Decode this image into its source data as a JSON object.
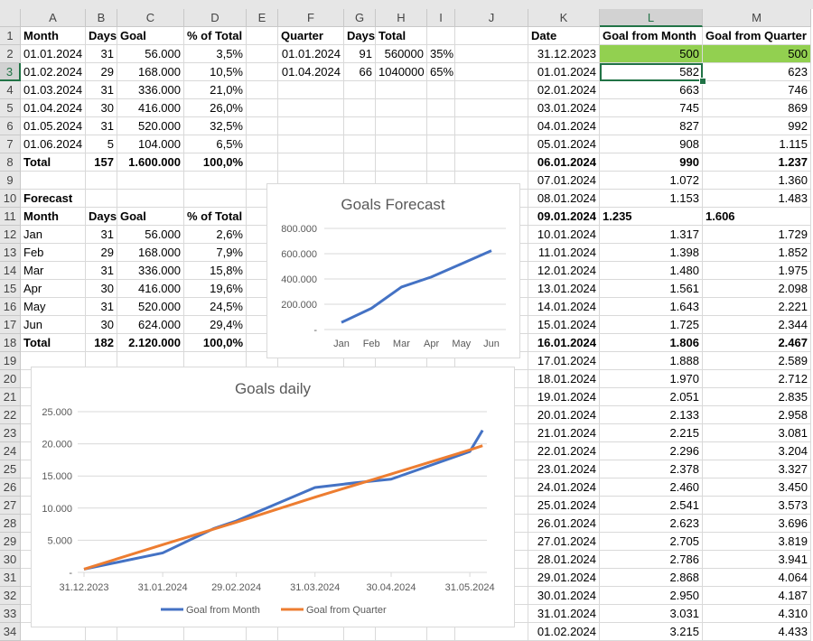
{
  "columns": [
    "A",
    "B",
    "C",
    "D",
    "E",
    "F",
    "G",
    "H",
    "I",
    "J",
    "K",
    "L",
    "M"
  ],
  "selected_cell": "L3",
  "colors": {
    "fill_highlight": "#92d050",
    "selection": "#217346",
    "series_month": "#4472c4",
    "series_quarter": "#ed7d31"
  },
  "cells": {
    "1": {
      "A": "Month",
      "B": "Days",
      "C": "Goal",
      "D": "% of Total",
      "F": "Quarter",
      "G": "Days",
      "H": "Total",
      "K": "Date",
      "L": "Goal from Month",
      "M": "Goal from Quarter"
    },
    "2": {
      "A": "01.01.2024",
      "B": "31",
      "C": "56.000",
      "D": "3,5%",
      "F": "01.01.2024",
      "G": "91",
      "H": "560000",
      "I": "35%",
      "K": "31.12.2023",
      "L": "500",
      "M": "500"
    },
    "3": {
      "A": "01.02.2024",
      "B": "29",
      "C": "168.000",
      "D": "10,5%",
      "F": "01.04.2024",
      "G": "66",
      "H": "1040000",
      "I": "65%",
      "K": "01.01.2024",
      "L": "582",
      "M": "623"
    },
    "4": {
      "A": "01.03.2024",
      "B": "31",
      "C": "336.000",
      "D": "21,0%",
      "K": "02.01.2024",
      "L": "663",
      "M": "746"
    },
    "5": {
      "A": "01.04.2024",
      "B": "30",
      "C": "416.000",
      "D": "26,0%",
      "K": "03.01.2024",
      "L": "745",
      "M": "869"
    },
    "6": {
      "A": "01.05.2024",
      "B": "31",
      "C": "520.000",
      "D": "32,5%",
      "K": "04.01.2024",
      "L": "827",
      "M": "992"
    },
    "7": {
      "A": "01.06.2024",
      "B": "5",
      "C": "104.000",
      "D": "6,5%",
      "K": "05.01.2024",
      "L": "908",
      "M": "1.115"
    },
    "8": {
      "A": "Total",
      "B": "157",
      "C": "1.600.000",
      "D": "100,0%",
      "K": "06.01.2024",
      "L": "990",
      "M": "1.237"
    },
    "9": {
      "K": "07.01.2024",
      "L": "1.072",
      "M": "1.360"
    },
    "10": {
      "A": "Forecast",
      "K": "08.01.2024",
      "L": "1.153",
      "M": "1.483"
    },
    "11": {
      "A": "Month",
      "B": "Days",
      "C": "Goal",
      "D": "% of Total",
      "K": "09.01.2024",
      "L": "1.235",
      "M": "1.606"
    },
    "12": {
      "A": "Jan",
      "B": "31",
      "C": "56.000",
      "D": "2,6%",
      "K": "10.01.2024",
      "L": "1.317",
      "M": "1.729"
    },
    "13": {
      "A": "Feb",
      "B": "29",
      "C": "168.000",
      "D": "7,9%",
      "K": "11.01.2024",
      "L": "1.398",
      "M": "1.852"
    },
    "14": {
      "A": "Mar",
      "B": "31",
      "C": "336.000",
      "D": "15,8%",
      "K": "12.01.2024",
      "L": "1.480",
      "M": "1.975"
    },
    "15": {
      "A": "Apr",
      "B": "30",
      "C": "416.000",
      "D": "19,6%",
      "K": "13.01.2024",
      "L": "1.561",
      "M": "2.098"
    },
    "16": {
      "A": "May",
      "B": "31",
      "C": "520.000",
      "D": "24,5%",
      "K": "14.01.2024",
      "L": "1.643",
      "M": "2.221"
    },
    "17": {
      "A": "Jun",
      "B": "30",
      "C": "624.000",
      "D": "29,4%",
      "K": "15.01.2024",
      "L": "1.725",
      "M": "2.344"
    },
    "18": {
      "A": "Total",
      "B": "182",
      "C": "2.120.000",
      "D": "100,0%",
      "K": "16.01.2024",
      "L": "1.806",
      "M": "2.467"
    },
    "19": {
      "K": "17.01.2024",
      "L": "1.888",
      "M": "2.589"
    },
    "20": {
      "K": "18.01.2024",
      "L": "1.970",
      "M": "2.712"
    },
    "21": {
      "K": "19.01.2024",
      "L": "2.051",
      "M": "2.835"
    },
    "22": {
      "K": "20.01.2024",
      "L": "2.133",
      "M": "2.958"
    },
    "23": {
      "K": "21.01.2024",
      "L": "2.215",
      "M": "3.081"
    },
    "24": {
      "K": "22.01.2024",
      "L": "2.296",
      "M": "3.204"
    },
    "25": {
      "K": "23.01.2024",
      "L": "2.378",
      "M": "3.327"
    },
    "26": {
      "K": "24.01.2024",
      "L": "2.460",
      "M": "3.450"
    },
    "27": {
      "K": "25.01.2024",
      "L": "2.541",
      "M": "3.573"
    },
    "28": {
      "K": "26.01.2024",
      "L": "2.623",
      "M": "3.696"
    },
    "29": {
      "K": "27.01.2024",
      "L": "2.705",
      "M": "3.819"
    },
    "30": {
      "K": "28.01.2024",
      "L": "2.786",
      "M": "3.941"
    },
    "31": {
      "K": "29.01.2024",
      "L": "2.868",
      "M": "4.064"
    },
    "32": {
      "K": "30.01.2024",
      "L": "2.950",
      "M": "4.187"
    },
    "33": {
      "K": "31.01.2024",
      "L": "3.031",
      "M": "4.310"
    },
    "34": {
      "K": "01.02.2024",
      "L": "3.215",
      "M": "4.433"
    }
  },
  "chart_data": [
    {
      "type": "line",
      "title": "Goals Forecast",
      "categories": [
        "Jan",
        "Feb",
        "Mar",
        "Apr",
        "May",
        "Jun"
      ],
      "series": [
        {
          "values": [
            56000,
            168000,
            336000,
            416000,
            520000,
            624000
          ],
          "color": "#4472c4"
        }
      ],
      "ylim": [
        0,
        800000
      ],
      "yticks": [
        "-",
        "200.000",
        "400.000",
        "600.000",
        "800.000"
      ],
      "grid": true,
      "legend": "none"
    },
    {
      "type": "line",
      "title": "Goals daily",
      "xticks": [
        "31.12.2023",
        "31.01.2024",
        "29.02.2024",
        "31.03.2024",
        "30.04.2024",
        "31.05.2024"
      ],
      "ylim": [
        0,
        25000
      ],
      "yticks": [
        "-",
        "5.000",
        "10.000",
        "15.000",
        "20.000",
        "25.000"
      ],
      "grid": true,
      "legend": "bottom",
      "series": [
        {
          "name": "Goal from Month",
          "color": "#4472c4",
          "x": [
            "31.12.2023",
            "31.01.2024",
            "20.02.2024",
            "29.02.2024",
            "31.03.2024",
            "15.04.2024",
            "30.04.2024",
            "31.05.2024",
            "05.06.2024"
          ],
          "y": [
            500,
            3031,
            6800,
            8000,
            13200,
            13900,
            14500,
            18800,
            22100
          ]
        },
        {
          "name": "Goal from Quarter",
          "color": "#ed7d31",
          "x": [
            "31.12.2023",
            "31.01.2024",
            "29.02.2024",
            "31.03.2024",
            "30.04.2024",
            "31.05.2024",
            "05.06.2024"
          ],
          "y": [
            500,
            4310,
            7800,
            11700,
            15300,
            19050,
            19700
          ]
        }
      ]
    }
  ]
}
